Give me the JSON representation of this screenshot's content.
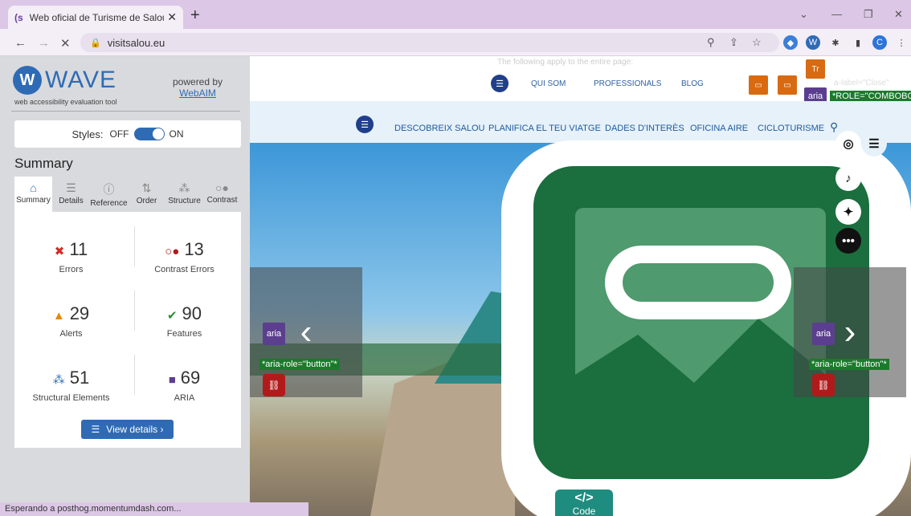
{
  "browser": {
    "tab_title": "Web oficial de Turisme de Salou |",
    "url": "visitsalou.eu",
    "profile_initial": "C",
    "status_text": "Esperando a posthog.momentumdash.com..."
  },
  "wave": {
    "logo_text": "WAVE",
    "subtitle": "web accessibility evaluation tool",
    "powered_by": "powered by",
    "powered_link": "WebAIM",
    "styles_label": "Styles:",
    "styles_off": "OFF",
    "styles_on": "ON",
    "summary_heading": "Summary",
    "tabs": [
      "Summary",
      "Details",
      "Reference",
      "Order",
      "Structure",
      "Contrast"
    ],
    "stats": [
      {
        "value": "11",
        "label": "Errors",
        "icon": "error-icon",
        "color": "#d42a2a"
      },
      {
        "value": "13",
        "label": "Contrast Errors",
        "icon": "contrast-error-icon",
        "color": "#b11a1a"
      },
      {
        "value": "29",
        "label": "Alerts",
        "icon": "alert-icon",
        "color": "#e58a00"
      },
      {
        "value": "90",
        "label": "Features",
        "icon": "feature-icon",
        "color": "#2e8b3a"
      },
      {
        "value": "51",
        "label": "Structural Elements",
        "icon": "structure-icon",
        "color": "#2f6bb5"
      },
      {
        "value": "69",
        "label": "ARIA",
        "icon": "aria-icon",
        "color": "#5b3f8e"
      }
    ],
    "view_details": "View details ›"
  },
  "site": {
    "top_links": [
      "QUI SOM",
      "PROFESSIONALS",
      "BLOG"
    ],
    "overlay_text": "The following apply to the entire page:",
    "aria_label_text": "a-label=\"Close\"",
    "role_text": "*ROLE=\"COMBOBO",
    "main_menu": [
      "DESCOBREIX SALOU",
      "PLANIFICA EL TEU VIATGE",
      "DADES D'INTERÈS",
      "OFICINA AIRE",
      "CICLOTURISME"
    ],
    "aria_badge": "aria",
    "aria_role_button": "*aria-role=\"button\"*",
    "code_label": "Code",
    "code_symbol": "</>"
  }
}
